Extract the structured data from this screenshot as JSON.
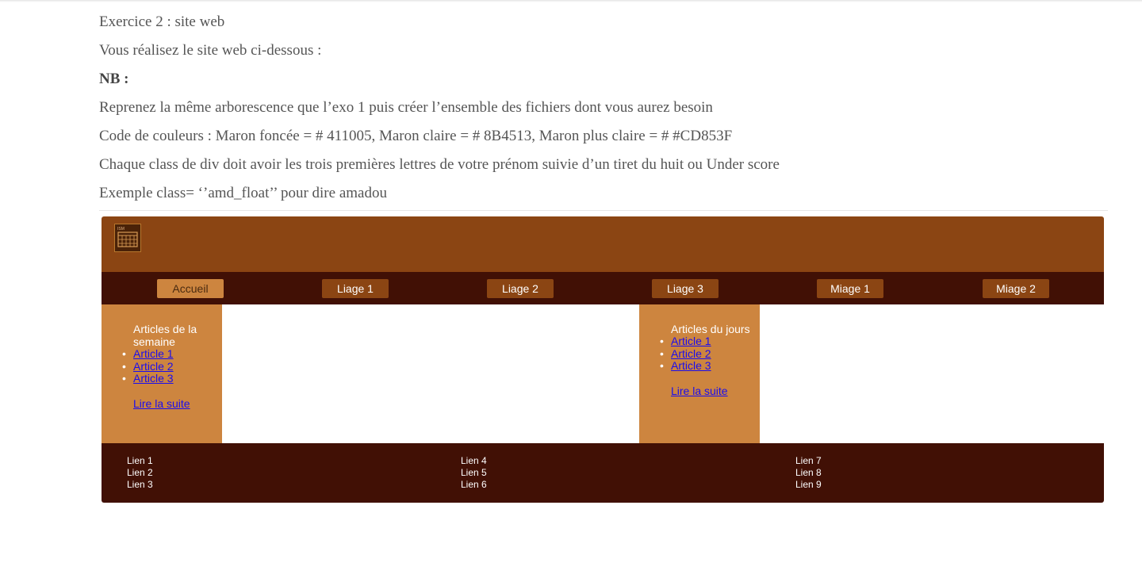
{
  "instructions": {
    "line1": "Exercice 2 : site web",
    "line2": "Vous réalisez le site web ci-dessous :",
    "line3": "NB :",
    "line4": "Reprenez la même arborescence que l’exo 1 puis créer l’ensemble des fichiers dont vous aurez besoin",
    "line5": "Code de couleurs : Maron foncée = # 411005, Maron claire = # 8B4513, Maron plus claire = # #CD853F",
    "line6": "Chaque class de div doit avoir les trois premières lettres de votre prénom suivie d’un tiret du huit ou Under score",
    "line7": "Exemple class= ‘’amd_float’’ pour dire amadou"
  },
  "site": {
    "logo_icon": "calendar-logo-icon",
    "logo_text": "ISM",
    "nav": [
      "Accueil",
      "Liage 1",
      "Liage 2",
      "Liage 3",
      "Miage 1",
      "Miage 2"
    ],
    "left_aside": {
      "title": "Articles de la semaine",
      "articles": [
        "Article 1",
        "Article 2",
        "Article 3"
      ],
      "more": "Lire la suite"
    },
    "right_aside": {
      "title": "Articles du jours",
      "articles": [
        "Article 1",
        "Article 2",
        "Article 3"
      ],
      "more": "Lire la suite"
    },
    "footer": {
      "col1": [
        "Lien 1",
        "Lien 2",
        "Lien 3"
      ],
      "col2": [
        "Lien 4",
        "Lien 5",
        "Lien 6"
      ],
      "col3": [
        "Lien 7",
        "Lien 8",
        "Lien 9"
      ]
    }
  },
  "colors": {
    "dark_brown": "#411005",
    "brown": "#8B4513",
    "light_brown": "#CD853F",
    "link": "#1a0dee"
  }
}
